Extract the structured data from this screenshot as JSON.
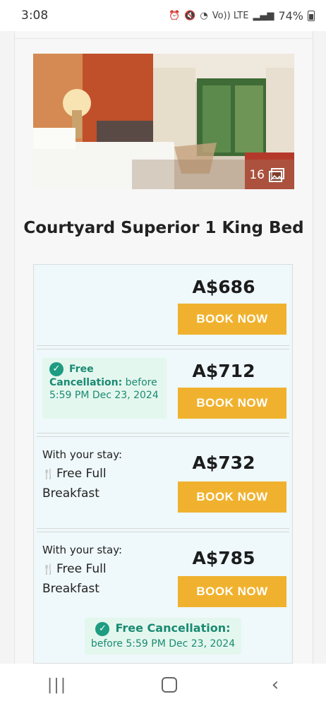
{
  "status": {
    "time": "3:08",
    "battery": "74%",
    "signal_label": "Vo)) LTE"
  },
  "hero": {
    "photo_count": "16"
  },
  "room": {
    "title": "Courtyard Superior 1 King Bed"
  },
  "rates": [
    {
      "price": "A$686",
      "button": "BOOK NOW"
    },
    {
      "price": "A$712",
      "button": "BOOK NOW",
      "cancel_title": "Free",
      "cancel_bold": "Cancellation:",
      "cancel_rest": " before 5:59 PM Dec 23, 2024"
    },
    {
      "price": "A$732",
      "button": "BOOK NOW",
      "with_stay": "With your stay:",
      "amenity": "Free Full Breakfast"
    },
    {
      "price": "A$785",
      "button": "BOOK NOW",
      "with_stay": "With your stay:",
      "amenity": "Free Full Breakfast",
      "bottom_cancel_title": "Free Cancellation:",
      "bottom_cancel_detail": "before 5:59 PM Dec 23, 2024"
    }
  ],
  "colors": {
    "accent": "#f0b22e",
    "cancel_green": "#1a8a73",
    "rate_bg": "#eff8fb"
  },
  "icons": {
    "photos": "gallery-icon",
    "check": "check-circle-icon",
    "meal": "fork-knife-icon"
  }
}
